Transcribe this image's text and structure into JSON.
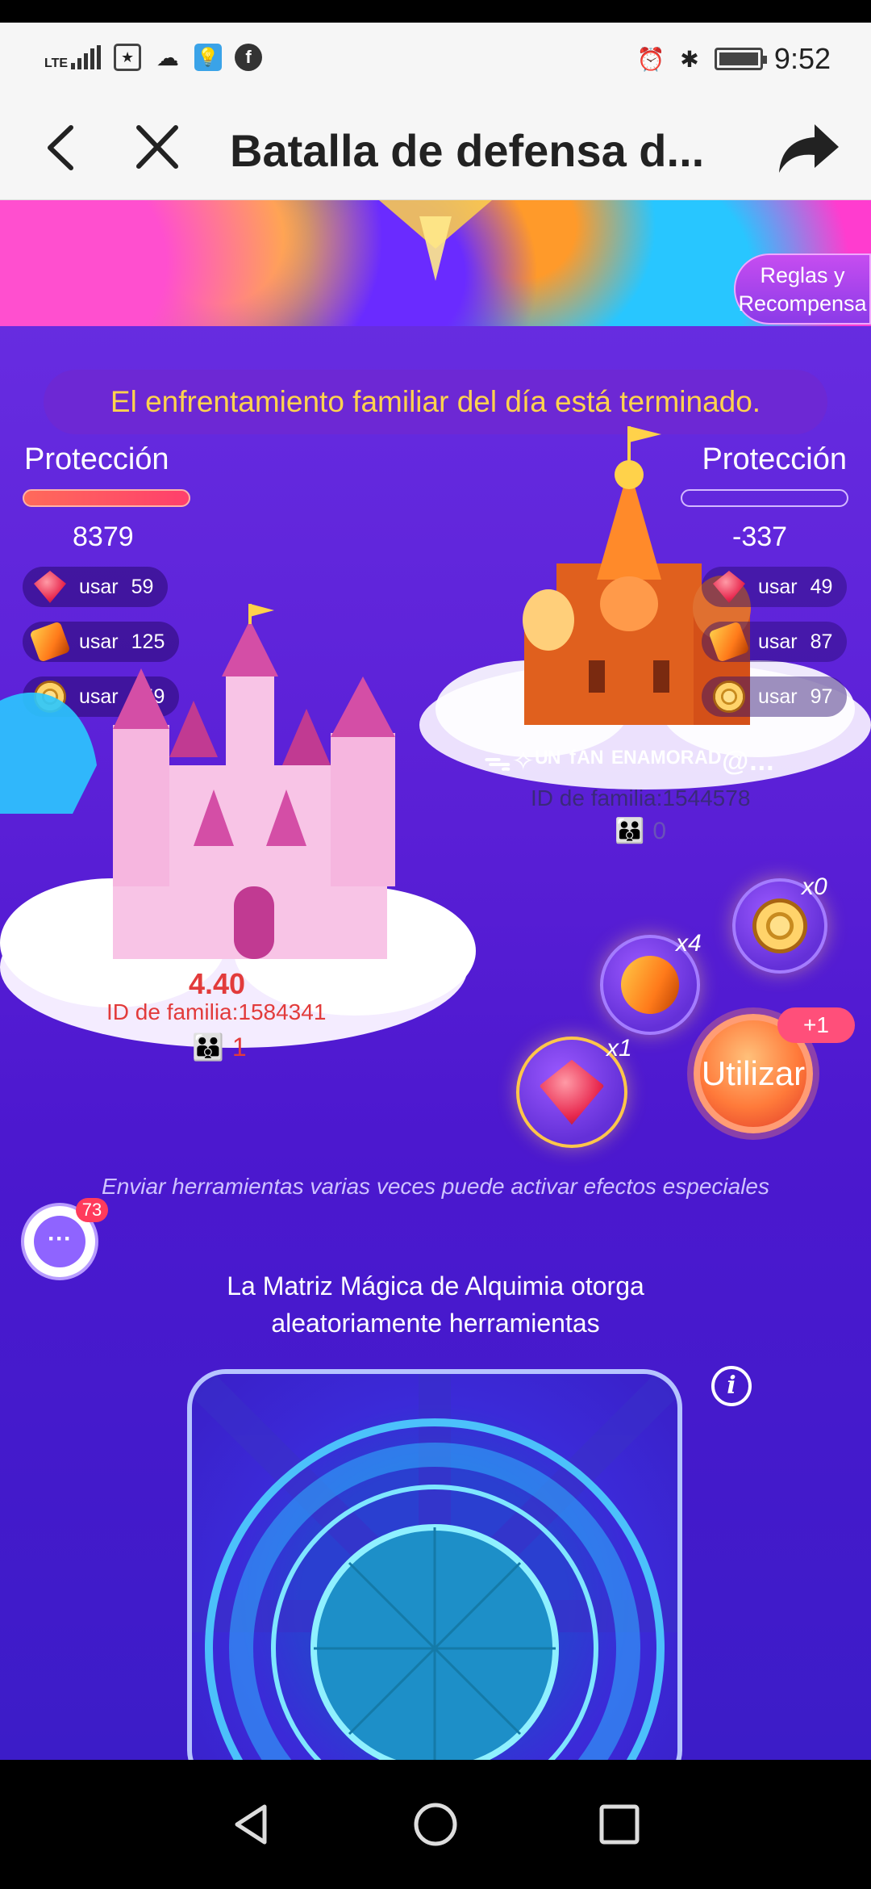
{
  "status_bar": {
    "network_label": "LTE",
    "time": "9:52"
  },
  "nav": {
    "title": "Batalla de defensa d...",
    "back_icon": "chevron-left-icon",
    "close_icon": "close-icon",
    "share_icon": "share-icon"
  },
  "rules_button": {
    "line1": "Reglas y",
    "line2": "Recompensa"
  },
  "day_ended_text": "El enfrentamiento familiar del día está terminado.",
  "left_side": {
    "label": "Protección",
    "score": "8379",
    "tools": [
      {
        "icon": "gem-icon",
        "label": "usar",
        "count": "59"
      },
      {
        "icon": "book-icon",
        "label": "usar",
        "count": "125"
      },
      {
        "icon": "ball-icon",
        "label": "usar",
        "count": "159"
      }
    ],
    "family_score": "4.40",
    "family_id": "ID de familia:1584341",
    "members": "1"
  },
  "right_side": {
    "label": "Protección",
    "score": "-337",
    "tools": [
      {
        "icon": "gem-icon",
        "label": "usar",
        "count": "49"
      },
      {
        "icon": "book-icon",
        "label": "usar",
        "count": "87"
      },
      {
        "icon": "ball-icon",
        "label": "usar",
        "count": "97"
      }
    ],
    "family_name": "ᯓ✧ᵁᴺ ᶠᴬᴺ ᴱᴺᴬᴹᴼᴿᴬᴰ@...",
    "family_id": "ID de familia:1544578",
    "members": "0"
  },
  "inventory": {
    "gem_count": "x1",
    "book_count": "x4",
    "ball_count": "x0"
  },
  "use_button": {
    "label": "Utilizar",
    "badge": "+1"
  },
  "hint": "Enviar herramientas varias veces puede activar efectos especiales",
  "chat": {
    "badge": "73"
  },
  "matrix": {
    "title_line1": "La Matriz Mágica de Alquimia otorga",
    "title_line2": "aleatoriamente herramientas"
  }
}
